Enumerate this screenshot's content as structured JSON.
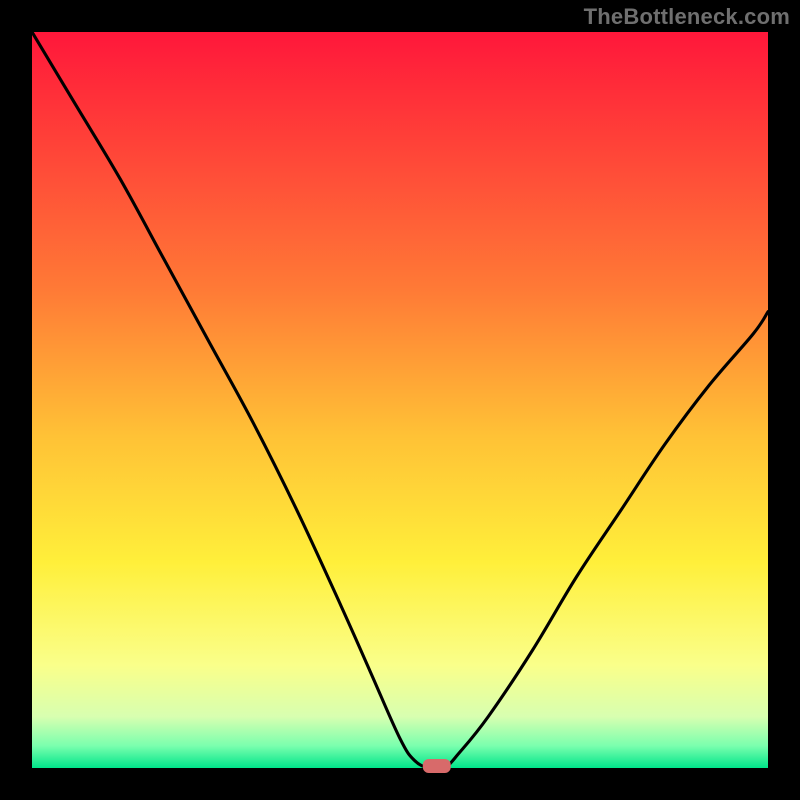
{
  "watermark": "TheBottleneck.com",
  "colors": {
    "marker_fill": "#d86a6a",
    "curve_stroke": "#000000",
    "gradient": {
      "0": "#ff173a",
      "35": "#ff7a36",
      "55": "#ffc236",
      "72": "#ffef3a",
      "86": "#faff8a",
      "93": "#d8ffb0",
      "97": "#7affae",
      "100": "#00e58a"
    }
  },
  "chart_data": {
    "type": "line",
    "title": "",
    "xlabel": "",
    "ylabel": "",
    "xlim": [
      0,
      100
    ],
    "ylim": [
      0,
      100
    ],
    "x": [
      0,
      6,
      12,
      18,
      24,
      30,
      36,
      42,
      46,
      50,
      52,
      54,
      56,
      58,
      62,
      68,
      74,
      80,
      86,
      92,
      98,
      100
    ],
    "y": [
      100,
      90,
      80,
      69,
      58,
      47,
      35,
      22,
      13,
      4,
      1,
      0,
      0,
      2,
      7,
      16,
      26,
      35,
      44,
      52,
      59,
      62
    ],
    "optimum_x": 55,
    "optimum_y": 0
  }
}
